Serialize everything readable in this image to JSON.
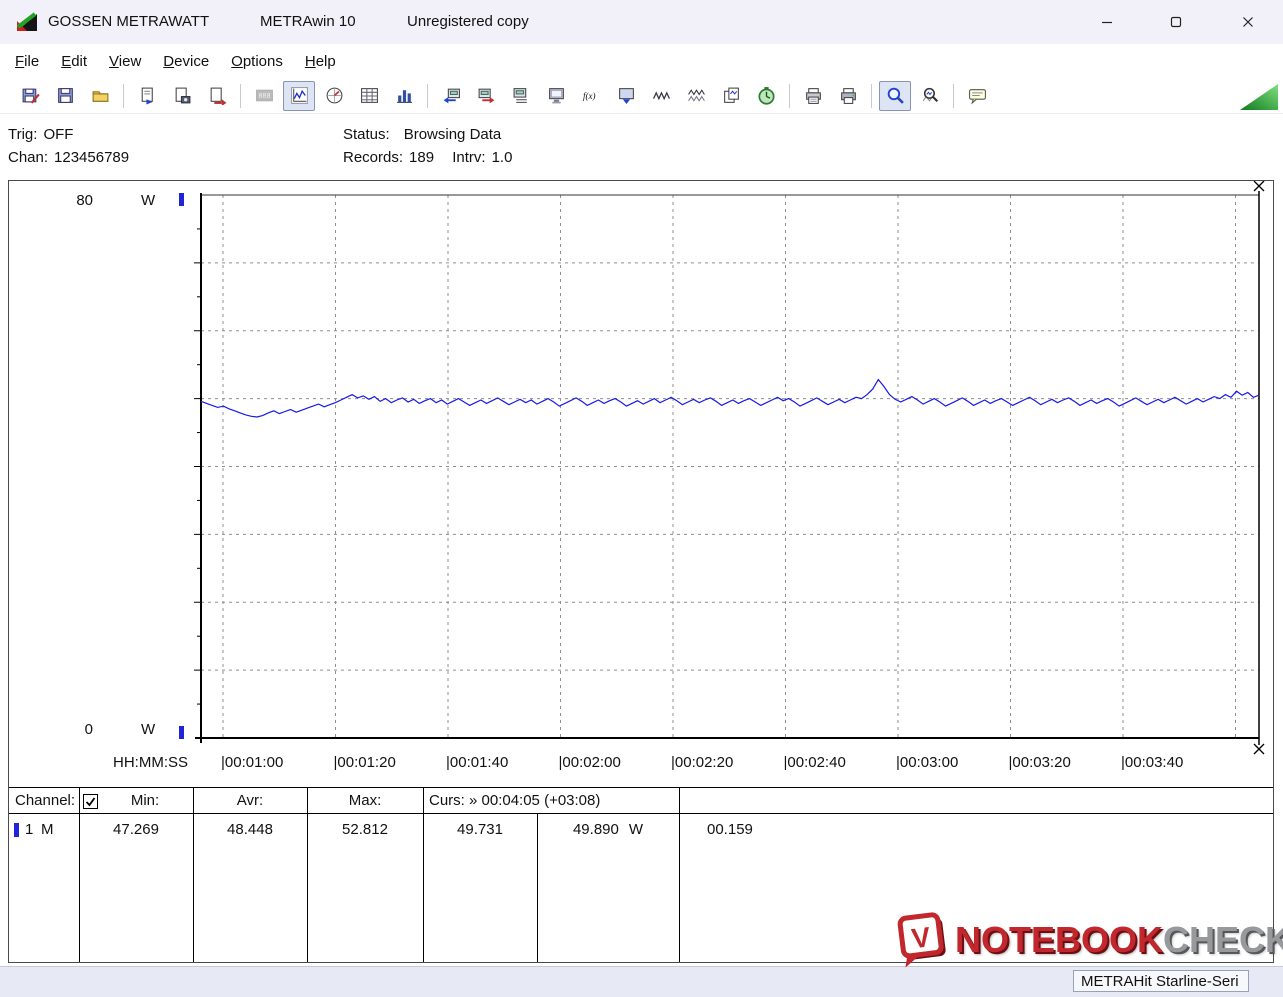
{
  "window": {
    "title_product": "GOSSEN METRAWATT",
    "title_app": "METRAwin 10",
    "title_status": "Unregistered copy"
  },
  "menu": {
    "items": [
      "File",
      "Edit",
      "View",
      "Device",
      "Options",
      "Help"
    ]
  },
  "toolbar": {
    "buttons": [
      {
        "name": "save-setup",
        "icon": "disk-pen"
      },
      {
        "name": "save",
        "icon": "disk"
      },
      {
        "name": "open",
        "icon": "folder"
      },
      {
        "sep": true
      },
      {
        "name": "export-text",
        "icon": "page-out"
      },
      {
        "name": "export-image",
        "icon": "page-cam"
      },
      {
        "name": "export-data",
        "icon": "page-arrow"
      },
      {
        "sep": true
      },
      {
        "name": "view-numeric-display",
        "icon": "lcd",
        "state": "disabled"
      },
      {
        "name": "view-yt-chart",
        "icon": "curve",
        "state": "pressed"
      },
      {
        "name": "view-analog-meter",
        "icon": "meter"
      },
      {
        "name": "view-table",
        "icon": "table"
      },
      {
        "name": "view-bargraph",
        "icon": "bars"
      },
      {
        "sep": true
      },
      {
        "name": "device-read",
        "icon": "dev-in"
      },
      {
        "name": "device-send",
        "icon": "dev-out"
      },
      {
        "name": "device-settings",
        "icon": "dev-list"
      },
      {
        "name": "device-monitor",
        "icon": "monitor"
      },
      {
        "name": "math-function",
        "icon": "fx"
      },
      {
        "name": "memory-transfer",
        "icon": "mem"
      },
      {
        "name": "signal-wave",
        "icon": "wave1"
      },
      {
        "name": "signal-envelope",
        "icon": "wave2"
      },
      {
        "name": "copy-curve",
        "icon": "pages"
      },
      {
        "name": "interval-timer",
        "icon": "clock"
      },
      {
        "sep": true
      },
      {
        "name": "print-preview",
        "icon": "printer-view"
      },
      {
        "name": "print",
        "icon": "printer"
      },
      {
        "sep": true
      },
      {
        "name": "zoom-mode",
        "icon": "zoom",
        "state": "pressed"
      },
      {
        "name": "zoom-reset",
        "icon": "zoom-wave"
      },
      {
        "sep": true
      },
      {
        "name": "annotation",
        "icon": "note"
      }
    ]
  },
  "info": {
    "trig_label": "Trig:",
    "trig_value": "OFF",
    "chan_label": "Chan:",
    "chan_value": "123456789",
    "status_label": "Status:",
    "status_value": "Browsing Data",
    "records_label": "Records:",
    "records_value": "189",
    "intrv_label": "Intrv:",
    "intrv_value": "1.0"
  },
  "chart_data": {
    "type": "line",
    "unit": "W",
    "ymax_label": "80",
    "ymin_label": "0",
    "ylim": [
      0,
      80
    ],
    "grid": true,
    "x_axis_label": "HH:MM:SS",
    "x_ticks": [
      "00:01:00",
      "00:01:20",
      "00:01:40",
      "00:02:00",
      "00:02:20",
      "00:02:40",
      "00:03:00",
      "00:03:20",
      "00:03:40"
    ],
    "x_tick_interval_s": 20,
    "stats": {
      "min": 47.269,
      "avr": 48.448,
      "max": 52.812
    },
    "cursor": {
      "time": "00:04:05",
      "offset": "+03:08",
      "value_a": 49.731,
      "value_b": 49.89,
      "delta": 0.159
    },
    "series": [
      {
        "name": "Channel 1",
        "color": "#1a1ae6",
        "values": [
          49.6,
          49.3,
          49.0,
          48.7,
          48.9,
          48.5,
          48.2,
          47.9,
          47.6,
          47.4,
          47.3,
          47.5,
          47.9,
          48.2,
          47.8,
          48.1,
          48.4,
          48.0,
          48.3,
          48.6,
          48.9,
          49.2,
          48.8,
          49.1,
          49.4,
          49.8,
          50.2,
          50.6,
          50.1,
          50.4,
          49.9,
          50.3,
          49.6,
          50.0,
          49.4,
          49.8,
          50.1,
          49.5,
          49.9,
          49.3,
          49.7,
          50.0,
          49.4,
          49.8,
          49.2,
          49.6,
          50.0,
          49.5,
          49.0,
          49.4,
          49.8,
          49.3,
          49.7,
          50.1,
          49.6,
          49.1,
          49.5,
          49.9,
          49.4,
          49.8,
          49.2,
          49.6,
          50.0,
          49.5,
          48.9,
          49.3,
          49.7,
          50.1,
          49.6,
          49.0,
          49.4,
          49.8,
          49.3,
          49.7,
          50.0,
          49.5,
          48.9,
          49.3,
          49.7,
          49.2,
          49.6,
          50.0,
          49.4,
          49.8,
          50.2,
          49.7,
          49.1,
          49.5,
          49.9,
          49.4,
          49.8,
          50.1,
          49.6,
          49.0,
          49.4,
          49.8,
          49.3,
          49.7,
          50.0,
          49.5,
          49.0,
          49.4,
          49.8,
          50.2,
          49.7,
          50.0,
          49.5,
          48.9,
          49.3,
          49.7,
          50.1,
          49.6,
          49.1,
          49.5,
          49.9,
          49.4,
          49.8,
          50.2,
          50.0,
          50.6,
          51.4,
          52.8,
          51.8,
          50.6,
          49.9,
          49.5,
          49.9,
          50.3,
          49.8,
          49.2,
          49.6,
          50.0,
          49.5,
          48.9,
          49.3,
          49.7,
          50.1,
          49.6,
          49.0,
          49.4,
          49.8,
          49.3,
          49.7,
          50.0,
          49.5,
          49.0,
          49.4,
          49.8,
          50.2,
          49.7,
          49.1,
          49.5,
          49.9,
          49.4,
          49.8,
          50.1,
          49.6,
          49.0,
          49.4,
          49.8,
          49.3,
          49.7,
          50.0,
          49.5,
          48.9,
          49.3,
          49.7,
          50.1,
          49.6,
          49.1,
          49.5,
          49.9,
          49.4,
          49.8,
          50.2,
          49.7,
          49.2,
          49.6,
          50.0,
          49.5,
          49.9,
          50.3,
          50.0,
          50.6,
          50.2,
          51.1,
          50.5,
          50.9,
          50.2,
          50.5
        ]
      }
    ]
  },
  "table": {
    "headers": {
      "channel": "Channel:",
      "min": "Min:",
      "avr": "Avr:",
      "max": "Max:",
      "curs": "Curs: » 00:04:05 (+03:08)"
    },
    "row": {
      "channel": "1",
      "mode": "M",
      "min": "47.269",
      "avr": "48.448",
      "max": "52.812",
      "curs_a": "49.731",
      "curs_b": "49.890",
      "curs_unit": "W",
      "delta": "00.159"
    }
  },
  "statusbar": {
    "device": "METRAHit Starline-Seri"
  },
  "watermark": {
    "text_red": "NOTEBOOK",
    "text_grey": "CHECK"
  }
}
